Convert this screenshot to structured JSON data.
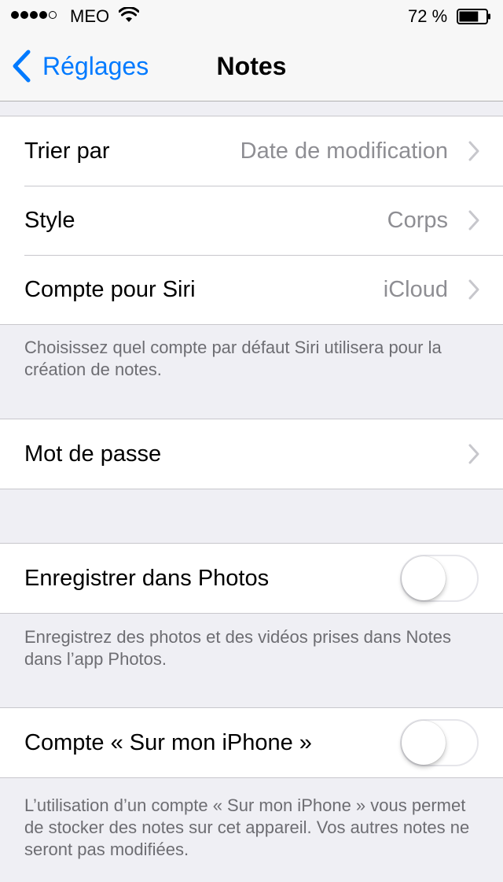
{
  "status_bar": {
    "signal_bars_filled": 4,
    "signal_bars_total": 5,
    "carrier": "MEO",
    "wifi_icon": "wifi-icon",
    "battery_percent": "72 %",
    "battery_level": 0.72
  },
  "nav": {
    "back_label": "Réglages",
    "title": "Notes"
  },
  "groups": {
    "sort": {
      "rows": [
        {
          "label": "Trier par",
          "value": "Date de modification"
        },
        {
          "label": "Style",
          "value": "Corps"
        },
        {
          "label": "Compte pour Siri",
          "value": "iCloud"
        }
      ],
      "footer": "Choisissez quel compte par défaut Siri utilisera pour la création de notes."
    },
    "password": {
      "label": "Mot de passe"
    },
    "save_photos": {
      "label": "Enregistrer dans Photos",
      "enabled": false,
      "footer": "Enregistrez des photos et des vidéos prises dans Notes dans l’app Photos."
    },
    "on_my_iphone": {
      "label": "Compte « Sur mon iPhone »",
      "enabled": false,
      "footer": "L’utilisation d’un compte « Sur mon iPhone » vous permet de stocker des notes sur cet appareil. Vos autres notes ne seront pas modifiées."
    }
  },
  "colors": {
    "accent": "#007aff",
    "background": "#efeff4",
    "secondary_text": "#8e8e93",
    "footer_text": "#6d6d72"
  }
}
